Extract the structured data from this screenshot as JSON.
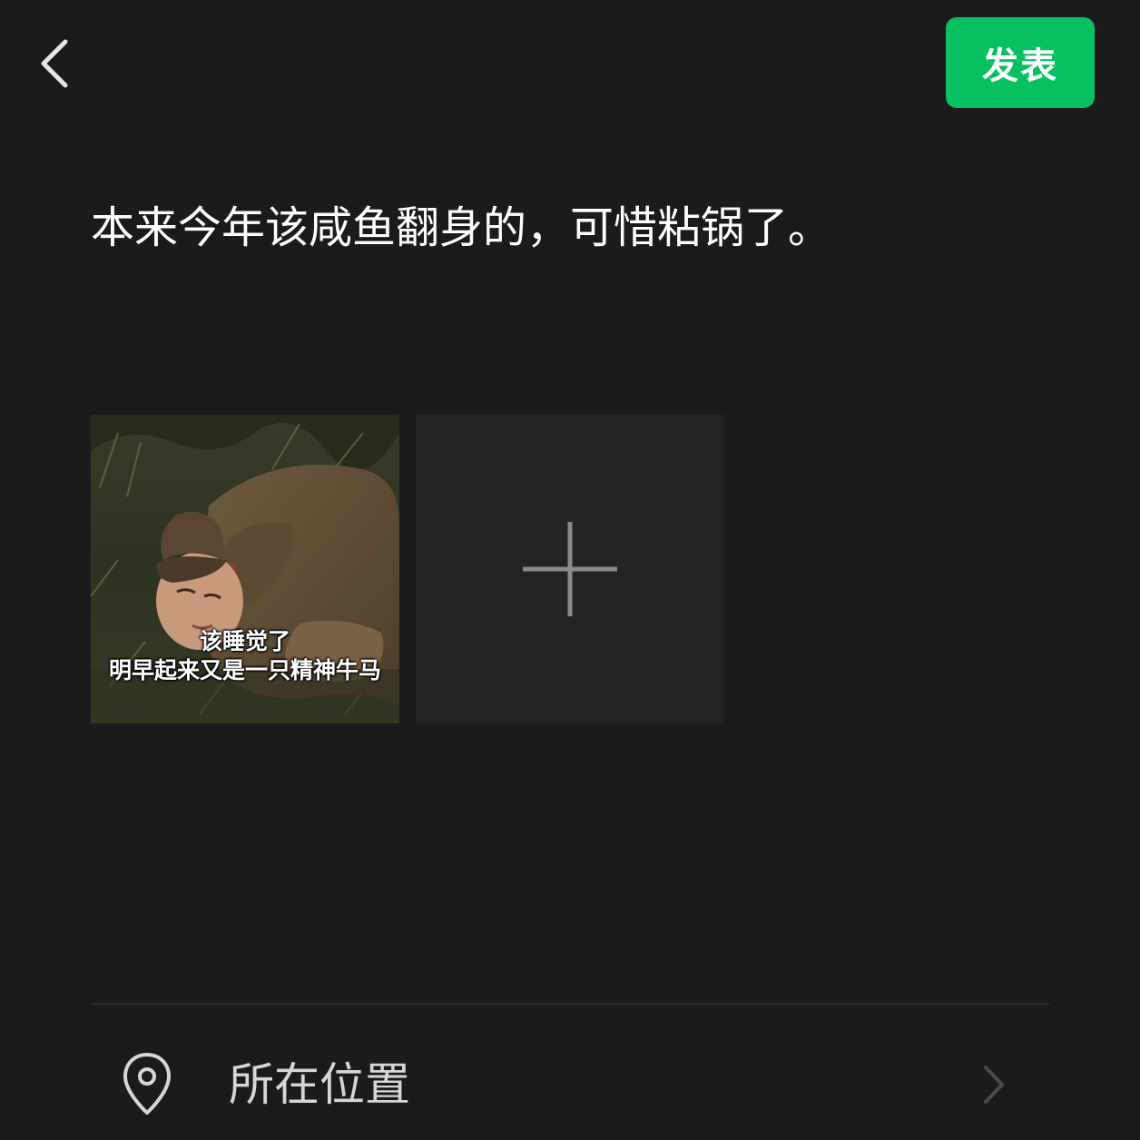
{
  "header": {
    "back_icon": "chevron-left-icon",
    "publish_label": "发表",
    "publish_color": "#07c160"
  },
  "post": {
    "text": "本来今年该咸鱼翻身的，可惜粘锅了。"
  },
  "media": {
    "images": [
      {
        "caption_lines": [
          "该睡觉了",
          "明早起来又是一只精神牛马"
        ]
      }
    ],
    "add_icon": "plus-icon"
  },
  "location": {
    "icon": "location-pin-icon",
    "label": "所在位置",
    "chevron_icon": "chevron-right-icon"
  },
  "colors": {
    "background": "#1b1b1c",
    "tile": "#232323",
    "accent": "#07c160"
  }
}
